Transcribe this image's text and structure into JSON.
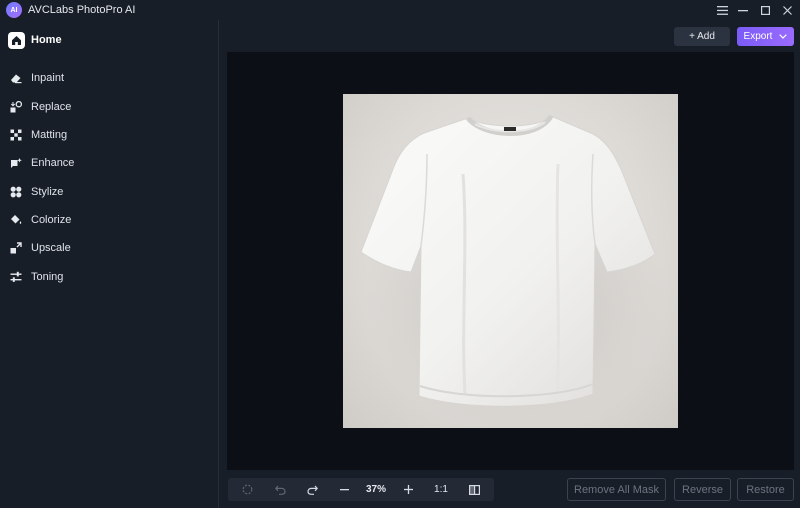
{
  "app": {
    "logo_text": "AI",
    "title": "AVCLabs PhotoPro AI"
  },
  "window_controls": [
    "menu-icon",
    "minimize-icon",
    "maximize-icon",
    "close-icon"
  ],
  "sidebar": {
    "home_label": "Home",
    "items": [
      {
        "label": "Inpaint",
        "icon": "eraser-icon"
      },
      {
        "label": "Replace",
        "icon": "replace-icon"
      },
      {
        "label": "Matting",
        "icon": "matting-icon"
      },
      {
        "label": "Enhance",
        "icon": "enhance-icon"
      },
      {
        "label": "Stylize",
        "icon": "stylize-icon"
      },
      {
        "label": "Colorize",
        "icon": "colorize-icon"
      },
      {
        "label": "Upscale",
        "icon": "upscale-icon"
      },
      {
        "label": "Toning",
        "icon": "toning-icon"
      }
    ]
  },
  "top_actions": {
    "add_label": "+ Add",
    "export_label": "Export"
  },
  "bottom_toolbar": {
    "zoom_level": "37%",
    "actual_size_label": "1:1"
  },
  "mask_actions": {
    "remove_all_mask": "Remove All Mask",
    "reverse": "Reverse",
    "restore": "Restore"
  },
  "colors": {
    "accent": "#8a63f8",
    "background": "#181e27",
    "canvas": "#0c1016"
  }
}
